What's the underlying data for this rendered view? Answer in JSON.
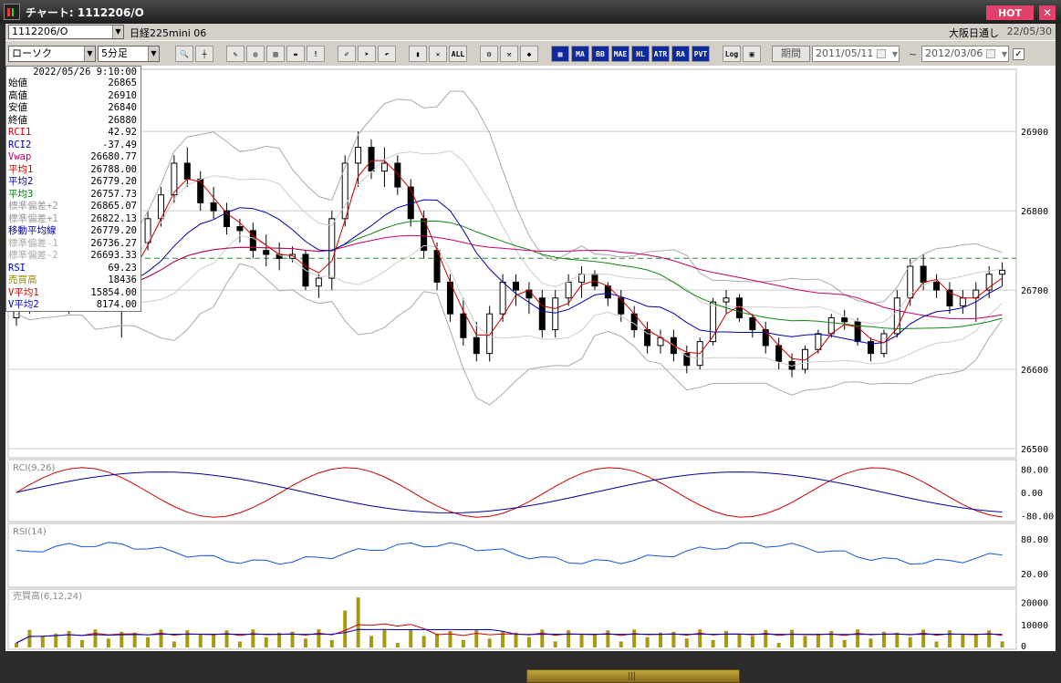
{
  "window": {
    "title": "チャート: 1112206/O",
    "hot_label": "HOT",
    "close_label": "✕"
  },
  "header": {
    "symbol_code": "1112206/O",
    "symbol_name": "日経225mini 06",
    "exchange": "大阪日通し",
    "date": "22/05/30"
  },
  "toolbar": {
    "chart_type": "ローソク",
    "interval": "5分足",
    "indicator_buttons": [
      "MA",
      "BB",
      "MAE",
      "HL",
      "ATR",
      "RA",
      "PVT"
    ],
    "log_label": "Log",
    "period_label": "期間",
    "date_from": "2011/05/11",
    "date_to": "2012/03/06",
    "tilde": "~",
    "check": "✓"
  },
  "data_window": {
    "timestamp": "2022/05/26 9:10:00",
    "rows": [
      {
        "label": "始値",
        "value": "26865",
        "color": "#000000"
      },
      {
        "label": "高値",
        "value": "26910",
        "color": "#000000"
      },
      {
        "label": "安値",
        "value": "26840",
        "color": "#000000"
      },
      {
        "label": "終値",
        "value": "26880",
        "color": "#000000"
      },
      {
        "label": "RCI1",
        "value": "42.92",
        "color": "#cc0000"
      },
      {
        "label": "RCI2",
        "value": "-37.49",
        "color": "#000099"
      },
      {
        "label": "Vwap",
        "value": "26680.77",
        "color": "#cc0066"
      },
      {
        "label": "平均1",
        "value": "26788.00",
        "color": "#cc0000"
      },
      {
        "label": "平均2",
        "value": "26779.20",
        "color": "#000099"
      },
      {
        "label": "平均3",
        "value": "26757.73",
        "color": "#007700"
      },
      {
        "label": "標準偏差+2",
        "value": "26865.07",
        "color": "#999999"
      },
      {
        "label": "標準偏差+1",
        "value": "26822.13",
        "color": "#999999"
      },
      {
        "label": "移動平均線",
        "value": "26779.20",
        "color": "#000099"
      },
      {
        "label": "標準偏差-1",
        "value": "26736.27",
        "color": "#aaaaaa"
      },
      {
        "label": "標準偏差-2",
        "value": "26693.33",
        "color": "#aaaaaa"
      },
      {
        "label": "RSI",
        "value": "69.23",
        "color": "#0000cc"
      },
      {
        "label": "売買高",
        "value": "18436",
        "color": "#998800"
      },
      {
        "label": "V平均1",
        "value": "15854.00",
        "color": "#cc0000"
      },
      {
        "label": "V平均2",
        "value": "8174.00",
        "color": "#0000cc"
      }
    ]
  },
  "panels": {
    "rci_label": "RCI(9,26)",
    "rsi_label": "RSI(14)",
    "volume_label": "売買高(6,12,24)",
    "rci_ticks": [
      "80.00",
      "0.00",
      "-80.00"
    ],
    "rsi_ticks": [
      "80.00",
      "20.00"
    ],
    "vol_ticks": [
      "20000",
      "10000",
      "0"
    ]
  },
  "x_axis": {
    "labels": [
      "1",
      "4",
      "26/8:45",
      "11",
      "14",
      "16:30",
      "19"
    ]
  },
  "chart_data": {
    "type": "candlestick",
    "price_axis": {
      "ticks": [
        26500,
        26600,
        26700,
        26800,
        26900
      ],
      "range": [
        26500,
        26960
      ]
    },
    "reference_level": 26740,
    "ohlc": [
      [
        26665,
        26690,
        26655,
        26680
      ],
      [
        26680,
        26700,
        26670,
        26695
      ],
      [
        26695,
        26710,
        26680,
        26700
      ],
      [
        26700,
        26705,
        26685,
        26690
      ],
      [
        26690,
        26700,
        26670,
        26695
      ],
      [
        26695,
        26715,
        26690,
        26705
      ],
      [
        26705,
        26760,
        26700,
        26750
      ],
      [
        26750,
        26760,
        26690,
        26700
      ],
      [
        26700,
        26730,
        26640,
        26720
      ],
      [
        26720,
        26770,
        26710,
        26760
      ],
      [
        26760,
        26800,
        26750,
        26790
      ],
      [
        26790,
        26830,
        26780,
        26820
      ],
      [
        26820,
        26870,
        26810,
        26860
      ],
      [
        26860,
        26880,
        26830,
        26840
      ],
      [
        26840,
        26850,
        26800,
        26810
      ],
      [
        26810,
        26830,
        26790,
        26800
      ],
      [
        26800,
        26810,
        26770,
        26780
      ],
      [
        26780,
        26790,
        26760,
        26775
      ],
      [
        26775,
        26785,
        26740,
        26750
      ],
      [
        26750,
        26770,
        26730,
        26745
      ],
      [
        26745,
        26760,
        26725,
        26740
      ],
      [
        26740,
        26755,
        26735,
        26745
      ],
      [
        26745,
        26750,
        26700,
        26705
      ],
      [
        26705,
        26720,
        26690,
        26715
      ],
      [
        26715,
        26800,
        26700,
        26790
      ],
      [
        26790,
        26870,
        26780,
        26860
      ],
      [
        26860,
        26900,
        26830,
        26880
      ],
      [
        26880,
        26890,
        26840,
        26850
      ],
      [
        26850,
        26880,
        26830,
        26860
      ],
      [
        26860,
        26870,
        26820,
        26830
      ],
      [
        26830,
        26840,
        26780,
        26790
      ],
      [
        26790,
        26800,
        26740,
        26750
      ],
      [
        26750,
        26760,
        26700,
        26710
      ],
      [
        26710,
        26720,
        26660,
        26670
      ],
      [
        26670,
        26690,
        26630,
        26640
      ],
      [
        26640,
        26660,
        26610,
        26620
      ],
      [
        26620,
        26680,
        26610,
        26670
      ],
      [
        26670,
        26720,
        26660,
        26710
      ],
      [
        26710,
        26720,
        26680,
        26700
      ],
      [
        26700,
        26710,
        26670,
        26690
      ],
      [
        26690,
        26700,
        26640,
        26650
      ],
      [
        26650,
        26700,
        26640,
        26690
      ],
      [
        26690,
        26720,
        26680,
        26710
      ],
      [
        26710,
        26730,
        26690,
        26720
      ],
      [
        26720,
        26725,
        26700,
        26705
      ],
      [
        26705,
        26710,
        26680,
        26690
      ],
      [
        26690,
        26700,
        26660,
        26670
      ],
      [
        26670,
        26680,
        26640,
        26650
      ],
      [
        26650,
        26660,
        26620,
        26630
      ],
      [
        26630,
        26650,
        26620,
        26640
      ],
      [
        26640,
        26650,
        26610,
        26620
      ],
      [
        26620,
        26630,
        26595,
        26605
      ],
      [
        26605,
        26640,
        26600,
        26635
      ],
      [
        26635,
        26690,
        26630,
        26685
      ],
      [
        26685,
        26700,
        26670,
        26690
      ],
      [
        26690,
        26695,
        26660,
        26665
      ],
      [
        26665,
        26670,
        26640,
        26650
      ],
      [
        26650,
        26660,
        26620,
        26630
      ],
      [
        26630,
        26640,
        26600,
        26610
      ],
      [
        26610,
        26620,
        26590,
        26600
      ],
      [
        26600,
        26630,
        26595,
        26625
      ],
      [
        26625,
        26650,
        26620,
        26645
      ],
      [
        26645,
        26670,
        26640,
        26665
      ],
      [
        26665,
        26675,
        26650,
        26660
      ],
      [
        26660,
        26665,
        26630,
        26635
      ],
      [
        26635,
        26640,
        26610,
        26620
      ],
      [
        26620,
        26650,
        26615,
        26645
      ],
      [
        26645,
        26700,
        26640,
        26690
      ],
      [
        26690,
        26740,
        26680,
        26730
      ],
      [
        26730,
        26745,
        26700,
        26710
      ],
      [
        26710,
        26720,
        26690,
        26700
      ],
      [
        26700,
        26710,
        26670,
        26680
      ],
      [
        26680,
        26700,
        26670,
        26690
      ],
      [
        26690,
        26710,
        26660,
        26700
      ],
      [
        26700,
        26730,
        26690,
        26720
      ],
      [
        26720,
        26735,
        26705,
        26725
      ]
    ],
    "rci_scale": [
      -100,
      100
    ],
    "rsi_scale": [
      0,
      100
    ],
    "volume_scale": [
      0,
      25000
    ]
  }
}
